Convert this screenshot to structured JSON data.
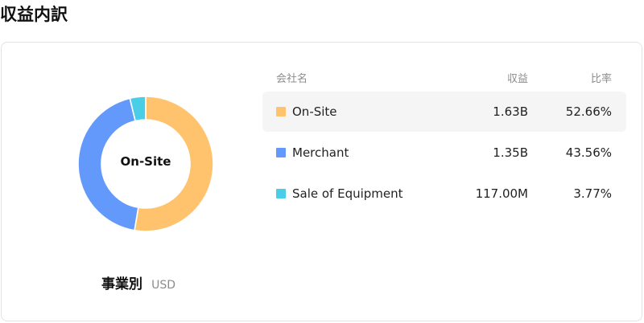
{
  "page": {
    "title": "収益内訳"
  },
  "donut": {
    "center_label": "On-Site"
  },
  "subtitle": {
    "main": "事業別",
    "unit": "USD"
  },
  "table": {
    "headers": {
      "name": "会社名",
      "value": "収益",
      "pct": "比率"
    },
    "rows": [
      {
        "name": "On-Site",
        "value": "1.63B",
        "pct": "52.66%",
        "color": "#FFC36E",
        "active": true
      },
      {
        "name": "Merchant",
        "value": "1.35B",
        "pct": "43.56%",
        "color": "#6399FA",
        "active": false
      },
      {
        "name": "Sale of Equipment",
        "value": "117.00M",
        "pct": "3.77%",
        "color": "#4ACDE6",
        "active": false
      }
    ]
  },
  "chart_data": {
    "type": "pie",
    "categories": [
      "On-Site",
      "Merchant",
      "Sale of Equipment"
    ],
    "values": [
      52.66,
      43.56,
      3.77
    ],
    "colors": [
      "#FFC36E",
      "#6399FA",
      "#4ACDE6"
    ],
    "donut": true,
    "legend": "table-right"
  }
}
